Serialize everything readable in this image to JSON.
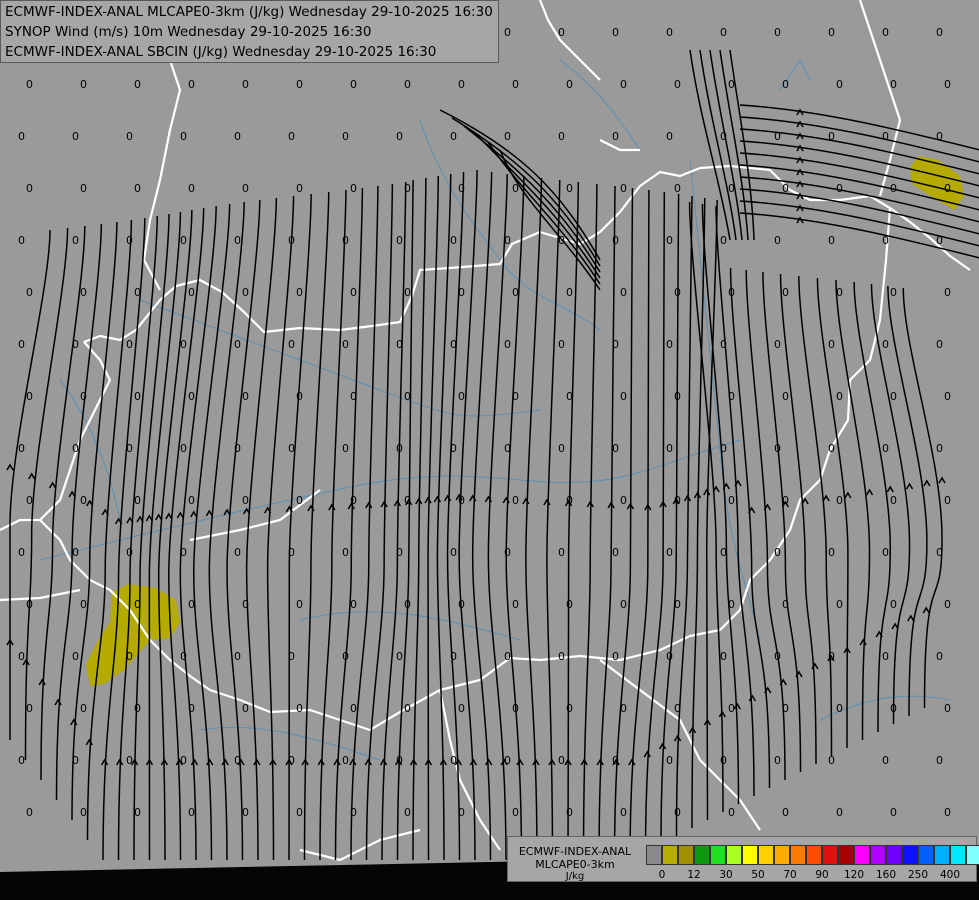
{
  "titles": [
    "ECMWF-INDEX-ANAL MLCAPE0-3km (J/kg) Wednesday 29-10-2025 16:30",
    "SYNOP Wind (m/s) 10m Wednesday 29-10-2025 16:30",
    "ECMWF-INDEX-ANAL SBCIN (J/kg) Wednesday 29-10-2025 16:30"
  ],
  "legend": {
    "line1": "ECMWF-INDEX-ANAL",
    "line2": "MLCAPE0-3km",
    "unit": "J/kg",
    "colors": [
      "#8a8a8a",
      "#b5ad00",
      "#a19000",
      "#0a9a0a",
      "#1ee01e",
      "#a8ff20",
      "#ffff00",
      "#ffd000",
      "#ffaa00",
      "#ff7a00",
      "#ff4a00",
      "#e01010",
      "#a80000",
      "#ff00ff",
      "#b000ff",
      "#7000ff",
      "#1010ff",
      "#0060ff",
      "#00b0ff",
      "#00e8ff",
      "#80ffff",
      "#ffffff"
    ],
    "ticks": [
      "0",
      "12",
      "30",
      "50",
      "70",
      "90",
      "120",
      "160",
      "250",
      "400"
    ]
  },
  "map": {
    "background": "#9a9a9a",
    "border_color": "#ffffff",
    "river_color": "#5a8fb4",
    "streamline_color": "#000000",
    "cape_patch_color": "#b4aa00",
    "cin_value_label": "0"
  }
}
